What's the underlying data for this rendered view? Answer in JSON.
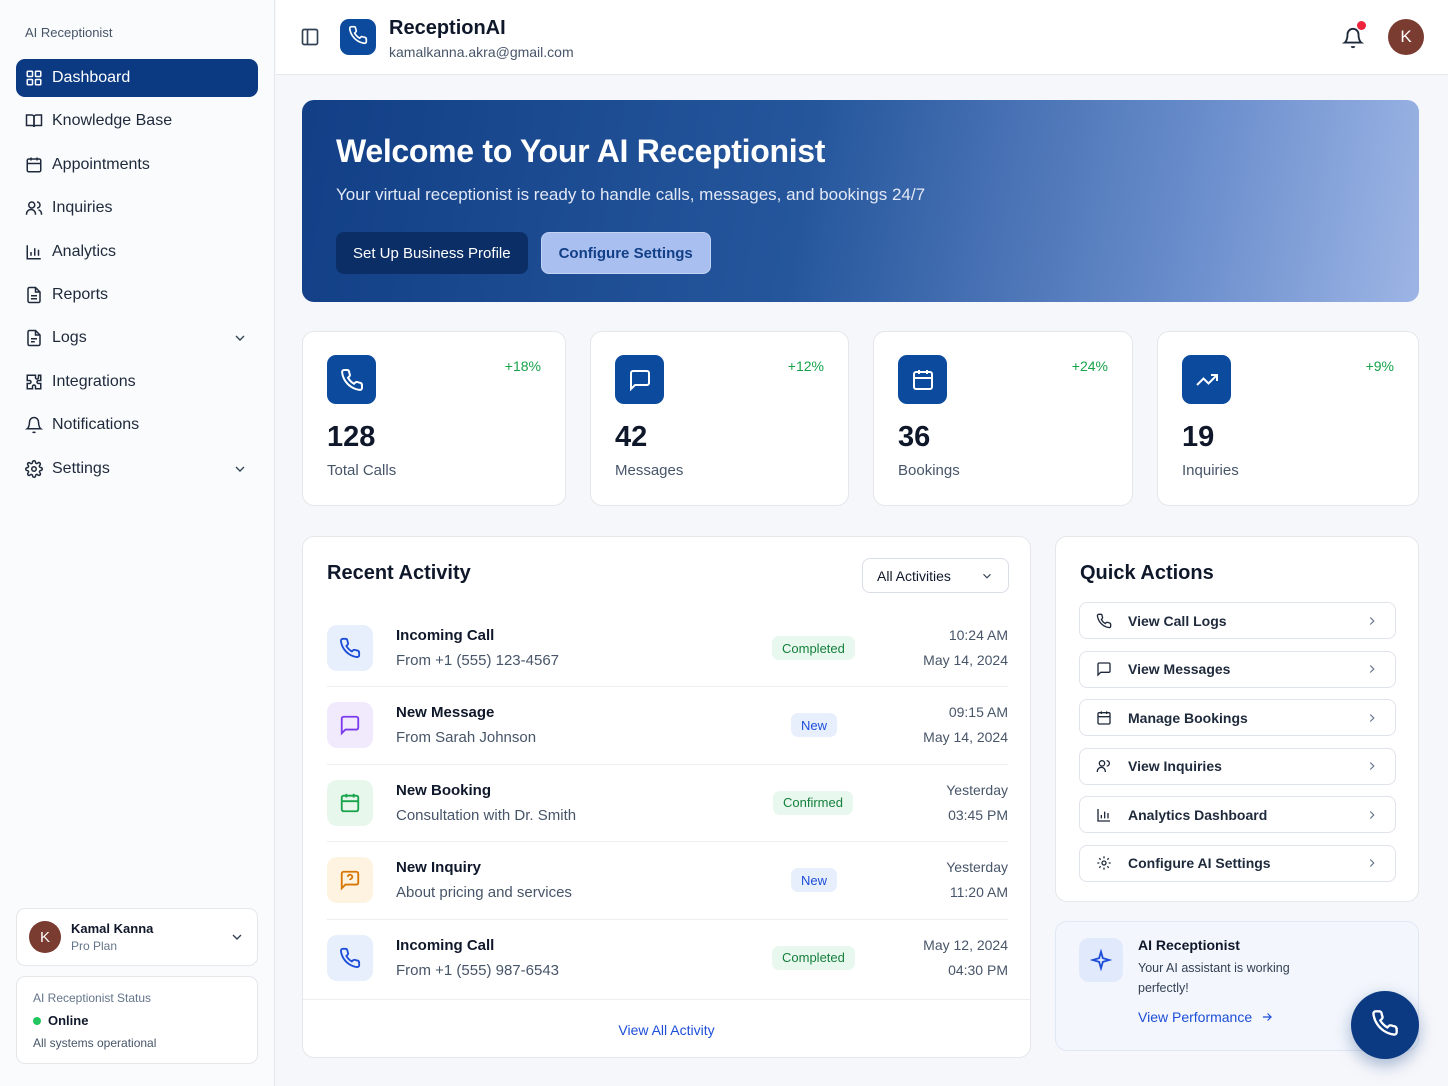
{
  "sidebar": {
    "title": "AI Receptionist",
    "items": [
      {
        "label": "Dashboard",
        "icon": "dashboard-grid-icon",
        "active": true
      },
      {
        "label": "Knowledge Base",
        "icon": "book-icon"
      },
      {
        "label": "Appointments",
        "icon": "calendar-icon"
      },
      {
        "label": "Inquiries",
        "icon": "users-icon"
      },
      {
        "label": "Analytics",
        "icon": "bar-chart-icon"
      },
      {
        "label": "Reports",
        "icon": "file-text-icon"
      },
      {
        "label": "Logs",
        "icon": "file-icon",
        "expandable": true
      },
      {
        "label": "Integrations",
        "icon": "puzzle-icon"
      },
      {
        "label": "Notifications",
        "icon": "bell-icon"
      },
      {
        "label": "Settings",
        "icon": "gear-icon",
        "expandable": true
      }
    ],
    "user": {
      "initial": "K",
      "name": "Kamal Kanna",
      "plan": "Pro Plan"
    },
    "status": {
      "label": "AI Receptionist Status",
      "state": "Online",
      "detail": "All systems operational"
    }
  },
  "header": {
    "brand": "ReceptionAI",
    "email": "kamalkanna.akra@gmail.com",
    "avatar_initial": "K"
  },
  "hero": {
    "title": "Welcome to Your AI Receptionist",
    "subtitle": "Your virtual receptionist is ready to handle calls, messages, and bookings 24/7",
    "primary_button": "Set Up Business Profile",
    "secondary_button": "Configure Settings"
  },
  "stats": [
    {
      "value": "128",
      "label": "Total Calls",
      "delta": "+18%",
      "icon": "phone-icon"
    },
    {
      "value": "42",
      "label": "Messages",
      "delta": "+12%",
      "icon": "message-icon"
    },
    {
      "value": "36",
      "label": "Bookings",
      "delta": "+24%",
      "icon": "calendar-icon"
    },
    {
      "value": "19",
      "label": "Inquiries",
      "delta": "+9%",
      "icon": "trending-up-icon"
    }
  ],
  "activity": {
    "title": "Recent Activity",
    "filter": "All Activities",
    "view_all": "View All Activity",
    "items": [
      {
        "title": "Incoming Call",
        "subtitle": "From +1 (555) 123-4567",
        "badge": "Completed",
        "time1": "10:24 AM",
        "time2": "May 14, 2024",
        "icon": "phone-icon"
      },
      {
        "title": "New Message",
        "subtitle": "From Sarah Johnson",
        "badge": "New",
        "time1": "09:15 AM",
        "time2": "May 14, 2024",
        "icon": "message-icon"
      },
      {
        "title": "New Booking",
        "subtitle": "Consultation with Dr. Smith",
        "badge": "Confirmed",
        "time1": "Yesterday",
        "time2": "03:45 PM",
        "icon": "calendar-icon"
      },
      {
        "title": "New Inquiry",
        "subtitle": "About pricing and services",
        "badge": "New",
        "time1": "Yesterday",
        "time2": "11:20 AM",
        "icon": "question-icon"
      },
      {
        "title": "Incoming Call",
        "subtitle": "From +1 (555) 987-6543",
        "badge": "Completed",
        "time1": "May 12, 2024",
        "time2": "04:30 PM",
        "icon": "phone-icon"
      }
    ]
  },
  "quick_actions": {
    "title": "Quick Actions",
    "items": [
      {
        "label": "View Call Logs",
        "icon": "phone-icon"
      },
      {
        "label": "View Messages",
        "icon": "message-icon"
      },
      {
        "label": "Manage Bookings",
        "icon": "calendar-icon"
      },
      {
        "label": "View Inquiries",
        "icon": "user-icon"
      },
      {
        "label": "Analytics Dashboard",
        "icon": "bar-chart-icon"
      },
      {
        "label": "Configure AI Settings",
        "icon": "gear-icon"
      }
    ]
  },
  "ai_card": {
    "title": "AI Receptionist",
    "text": "Your AI assistant is working perfectly!",
    "link": "View Performance"
  },
  "colors": {
    "primary": "#0b3a82",
    "success": "#16a34a",
    "notification_dot": "#ef233c"
  }
}
